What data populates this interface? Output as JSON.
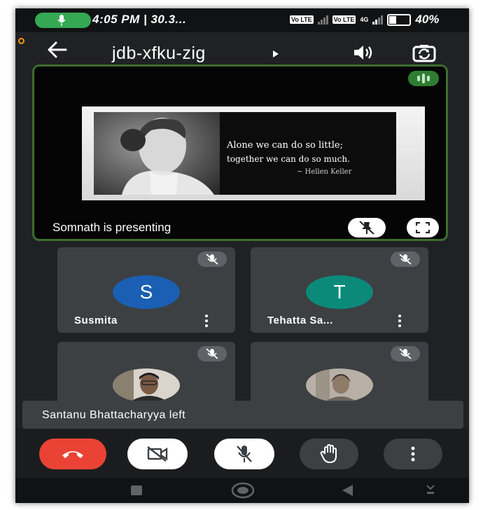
{
  "status_bar": {
    "time_date": "4:05 PM | 30.3...",
    "network_label": "4G",
    "battery": "40%"
  },
  "header": {
    "meeting_code": "jdb-xfku-zig"
  },
  "presentation": {
    "presenter_label": "Somnath is presenting",
    "slide": {
      "quote_line1": "Alone we can do so little;",
      "quote_line2": "together we can do so much.",
      "quote_author": "~ Hellen Keller"
    }
  },
  "participants": [
    {
      "name": "Susmita",
      "initial": "S",
      "avatar_color": "#1a5fb4",
      "muted": true
    },
    {
      "name": "Tehatta Sa...",
      "initial": "T",
      "avatar_color": "#0b8a7a",
      "muted": true
    },
    {
      "name": "",
      "initial": "",
      "avatar_color": "",
      "muted": true
    },
    {
      "name": "",
      "initial": "",
      "avatar_color": "",
      "muted": true
    }
  ],
  "toast": {
    "message": "Santanu Bhattacharyya left"
  },
  "controls": [
    {
      "icon": "end-call-icon",
      "color": "#ea4335"
    },
    {
      "icon": "camera-off-icon",
      "color": "#ffffff"
    },
    {
      "icon": "mic-off-icon",
      "color": "#ffffff"
    },
    {
      "icon": "raise-hand-icon",
      "color": "#3c4043"
    },
    {
      "icon": "more-options-icon",
      "color": "#3c4043"
    }
  ],
  "colors": {
    "active_speaker_border": "#3e6d2e",
    "audio_indicator": "#2e7d32",
    "background": "#202124",
    "tile": "#3c4043"
  }
}
